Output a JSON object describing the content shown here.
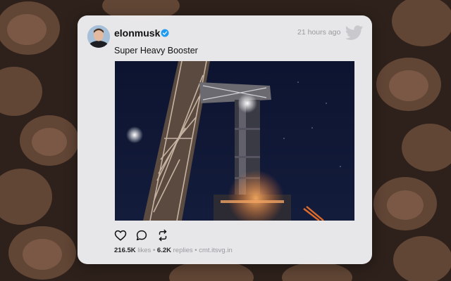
{
  "post": {
    "username": "elonmusk",
    "timestamp": "21 hours ago",
    "text": "Super Heavy Booster",
    "likes": "216.5K",
    "likes_label": "likes",
    "replies": "6.2K",
    "replies_label": "replies",
    "separator": "•",
    "source": "cmt.itsvg.in"
  },
  "colors": {
    "verified": "#1d9bf0",
    "twitter_icon": "#c9c9cd"
  },
  "icons": [
    "verified-badge-icon",
    "twitter-bird-icon",
    "heart-icon",
    "reply-icon",
    "retweet-icon"
  ]
}
